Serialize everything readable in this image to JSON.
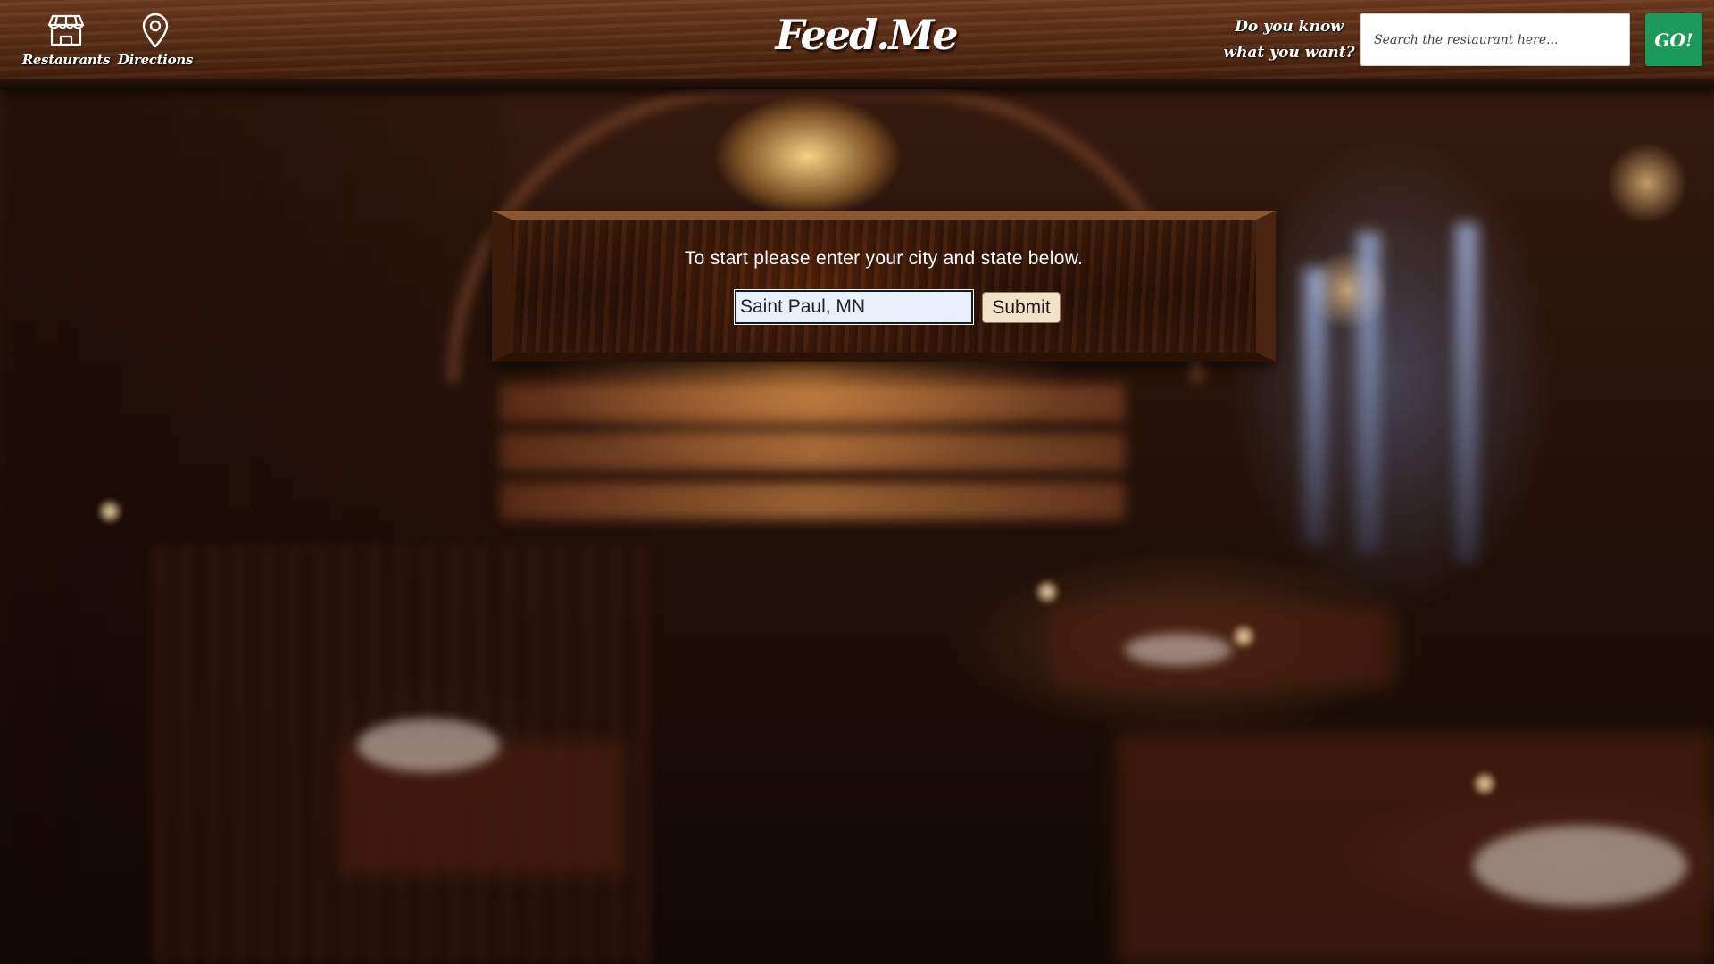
{
  "header": {
    "brand": "Feed.Me",
    "nav": [
      {
        "label": "Restaurants",
        "icon": "storefront-icon"
      },
      {
        "label": "Directions",
        "icon": "map-pin-icon"
      }
    ],
    "prompt_line1": "Do you know",
    "prompt_line2": "what you want?",
    "search_placeholder": "Search the restaurant here...",
    "search_value": "",
    "go_label": "GO!"
  },
  "panel": {
    "instruction": "To start please enter your city and state below.",
    "location_value": "Saint Paul, MN",
    "submit_label": "Submit"
  },
  "colors": {
    "go_button": "#1b9a5c",
    "submit_button": "#f1e1c7",
    "wood_dark": "#2d1206",
    "wood_header": "#5a2e16"
  }
}
